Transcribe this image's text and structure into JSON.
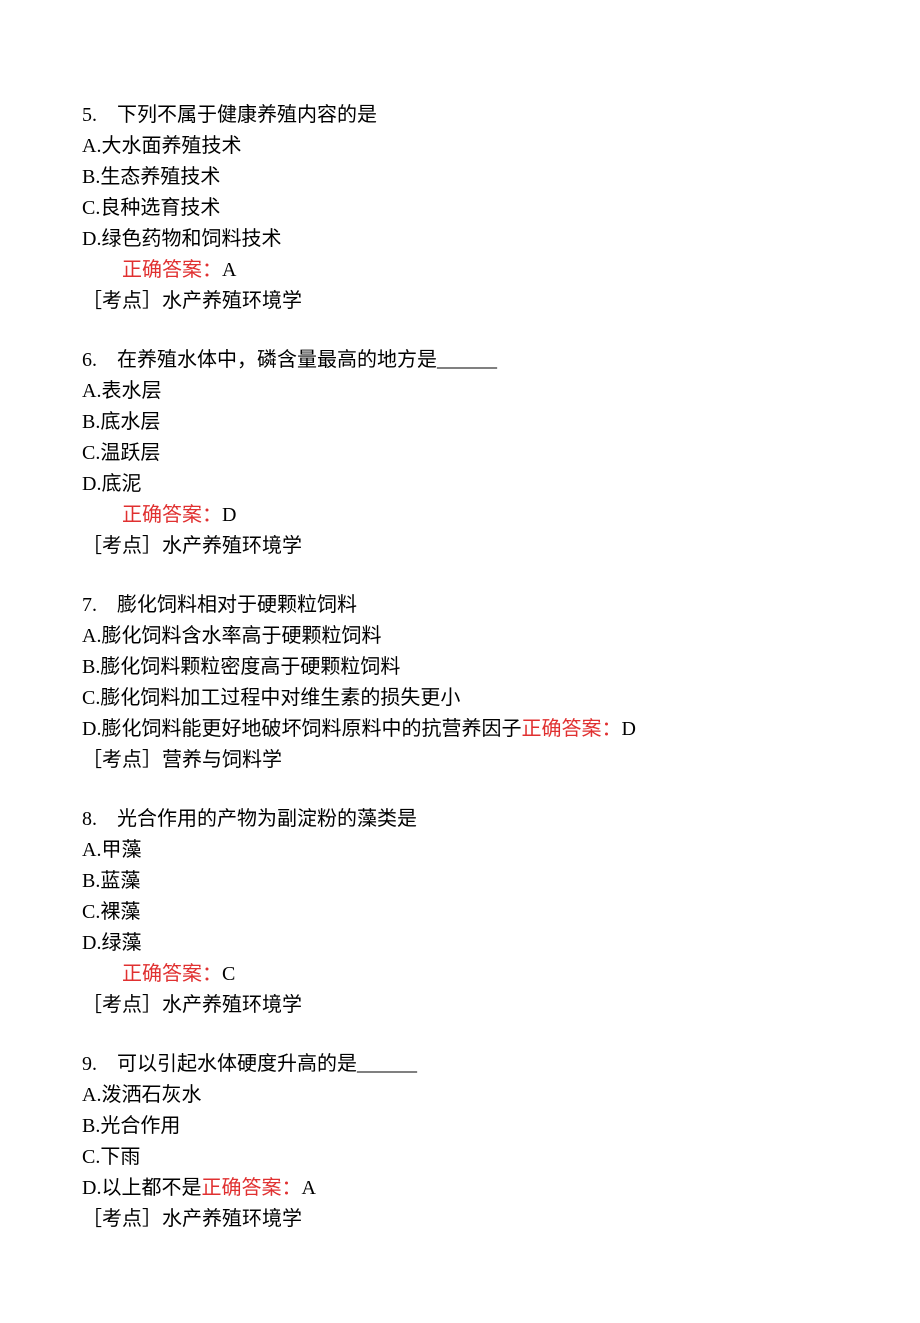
{
  "labels": {
    "answer_prefix": "正确答案：",
    "topic_prefix": "［考点］"
  },
  "questions": [
    {
      "num": "5.",
      "stem": "下列不属于健康养殖内容的是",
      "options": [
        "A.大水面养殖技术",
        "B.生态养殖技术",
        "C.良种选育技术",
        "D.绿色药物和饲料技术"
      ],
      "answer": "A",
      "topic": "水产养殖环境学",
      "inline_after_option": false
    },
    {
      "num": "6.",
      "stem": "在养殖水体中，磷含量最高的地方是______",
      "options": [
        "A.表水层",
        "B.底水层",
        "C.温跃层",
        "D.底泥"
      ],
      "answer": "D",
      "topic": "水产养殖环境学",
      "inline_after_option": false
    },
    {
      "num": "7.",
      "stem": "膨化饲料相对于硬颗粒饲料",
      "options": [
        "A.膨化饲料含水率高于硬颗粒饲料",
        "B.膨化饲料颗粒密度高于硬颗粒饲料",
        "C.膨化饲料加工过程中对维生素的损失更小",
        "D.膨化饲料能更好地破坏饲料原料中的抗营养因子"
      ],
      "answer": "D",
      "topic": "营养与饲料学",
      "inline_after_option": true
    },
    {
      "num": "8.",
      "stem": "光合作用的产物为副淀粉的藻类是",
      "options": [
        "A.甲藻",
        "B.蓝藻",
        "C.裸藻",
        "D.绿藻"
      ],
      "answer": "C",
      "topic": "水产养殖环境学",
      "inline_after_option": false
    },
    {
      "num": "9.",
      "stem": "可以引起水体硬度升高的是______",
      "options": [
        "A.泼洒石灰水",
        "B.光合作用",
        "C.下雨",
        "D.以上都不是"
      ],
      "answer": "A",
      "topic": "水产养殖环境学",
      "inline_after_option": true
    }
  ]
}
